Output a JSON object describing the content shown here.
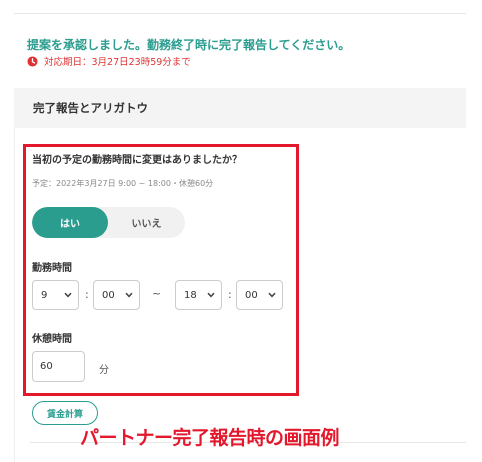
{
  "notice": {
    "message": "提案を承認しました。勤務終了時に完了報告してください。",
    "deadline": "対応期日：3月27日23時59分まで",
    "deadline_icon": "clock-icon"
  },
  "section": {
    "title": "完了報告とアリガトウ"
  },
  "form": {
    "question": "当初の予定の勤務時間に変更はありましたか？",
    "schedule_note": "予定：2022年3月27日 9:00 ~ 18:00・休憩60分",
    "toggle": {
      "yes": "はい",
      "no": "いいえ",
      "selected": "はい"
    },
    "work_time": {
      "label": "勤務時間",
      "start_hour": "9",
      "start_minute": "00",
      "separator": "~",
      "end_hour": "18",
      "end_minute": "00",
      "colon": ":"
    },
    "break_time": {
      "label": "休憩時間",
      "value": "60",
      "unit": "分"
    },
    "wage_button": "賃金計算"
  },
  "annotation": {
    "caption": "パートナー完了報告時の画面例",
    "color": "#e3182d"
  },
  "colors": {
    "accent": "#2a9d8f",
    "alert": "#dd3333"
  }
}
